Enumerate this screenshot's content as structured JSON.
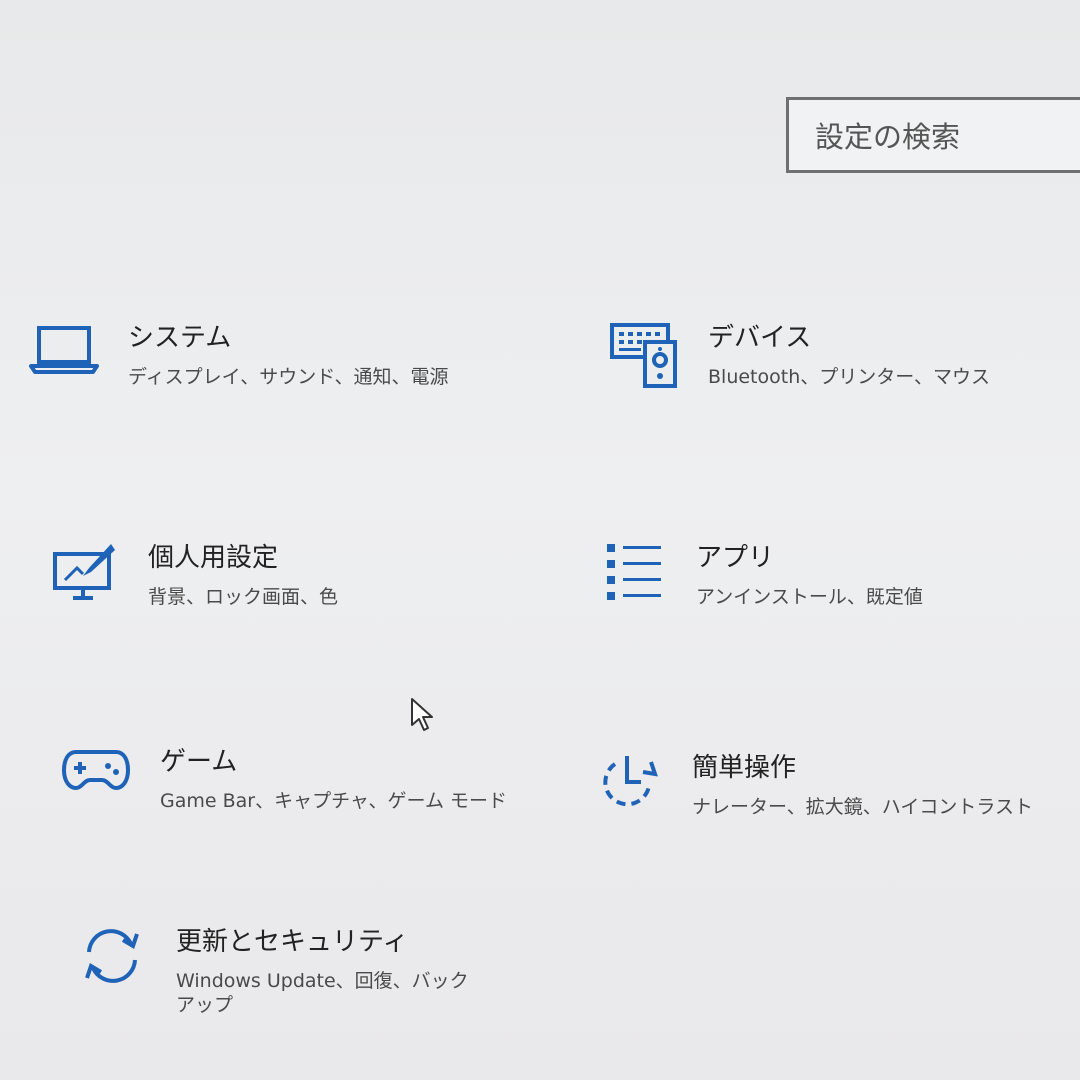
{
  "search": {
    "placeholder": "設定の検索"
  },
  "tiles": [
    {
      "id": "system",
      "title": "システム",
      "desc": "ディスプレイ、サウンド、通知、電源",
      "icon": "laptop-icon"
    },
    {
      "id": "devices",
      "title": "デバイス",
      "desc": "Bluetooth、プリンター、マウス",
      "icon": "devices-icon"
    },
    {
      "id": "personalization",
      "title": "個人用設定",
      "desc": "背景、ロック画面、色",
      "icon": "personalization-icon"
    },
    {
      "id": "apps",
      "title": "アプリ",
      "desc": "アンインストール、既定値",
      "icon": "apps-list-icon"
    },
    {
      "id": "gaming",
      "title": "ゲーム",
      "desc": "Game Bar、キャプチャ、ゲーム モード",
      "icon": "gamepad-icon"
    },
    {
      "id": "ease-of-access",
      "title": "簡単操作",
      "desc": "ナレーター、拡大鏡、ハイコントラスト",
      "icon": "ease-of-access-icon"
    },
    {
      "id": "update-security",
      "title": "更新とセキュリティ",
      "desc": "Windows Update、回復、バックアップ",
      "icon": "sync-icon"
    }
  ],
  "colors": {
    "accent": "#1f63b8",
    "background": "#ecedef",
    "text": "#2b2b2b"
  }
}
